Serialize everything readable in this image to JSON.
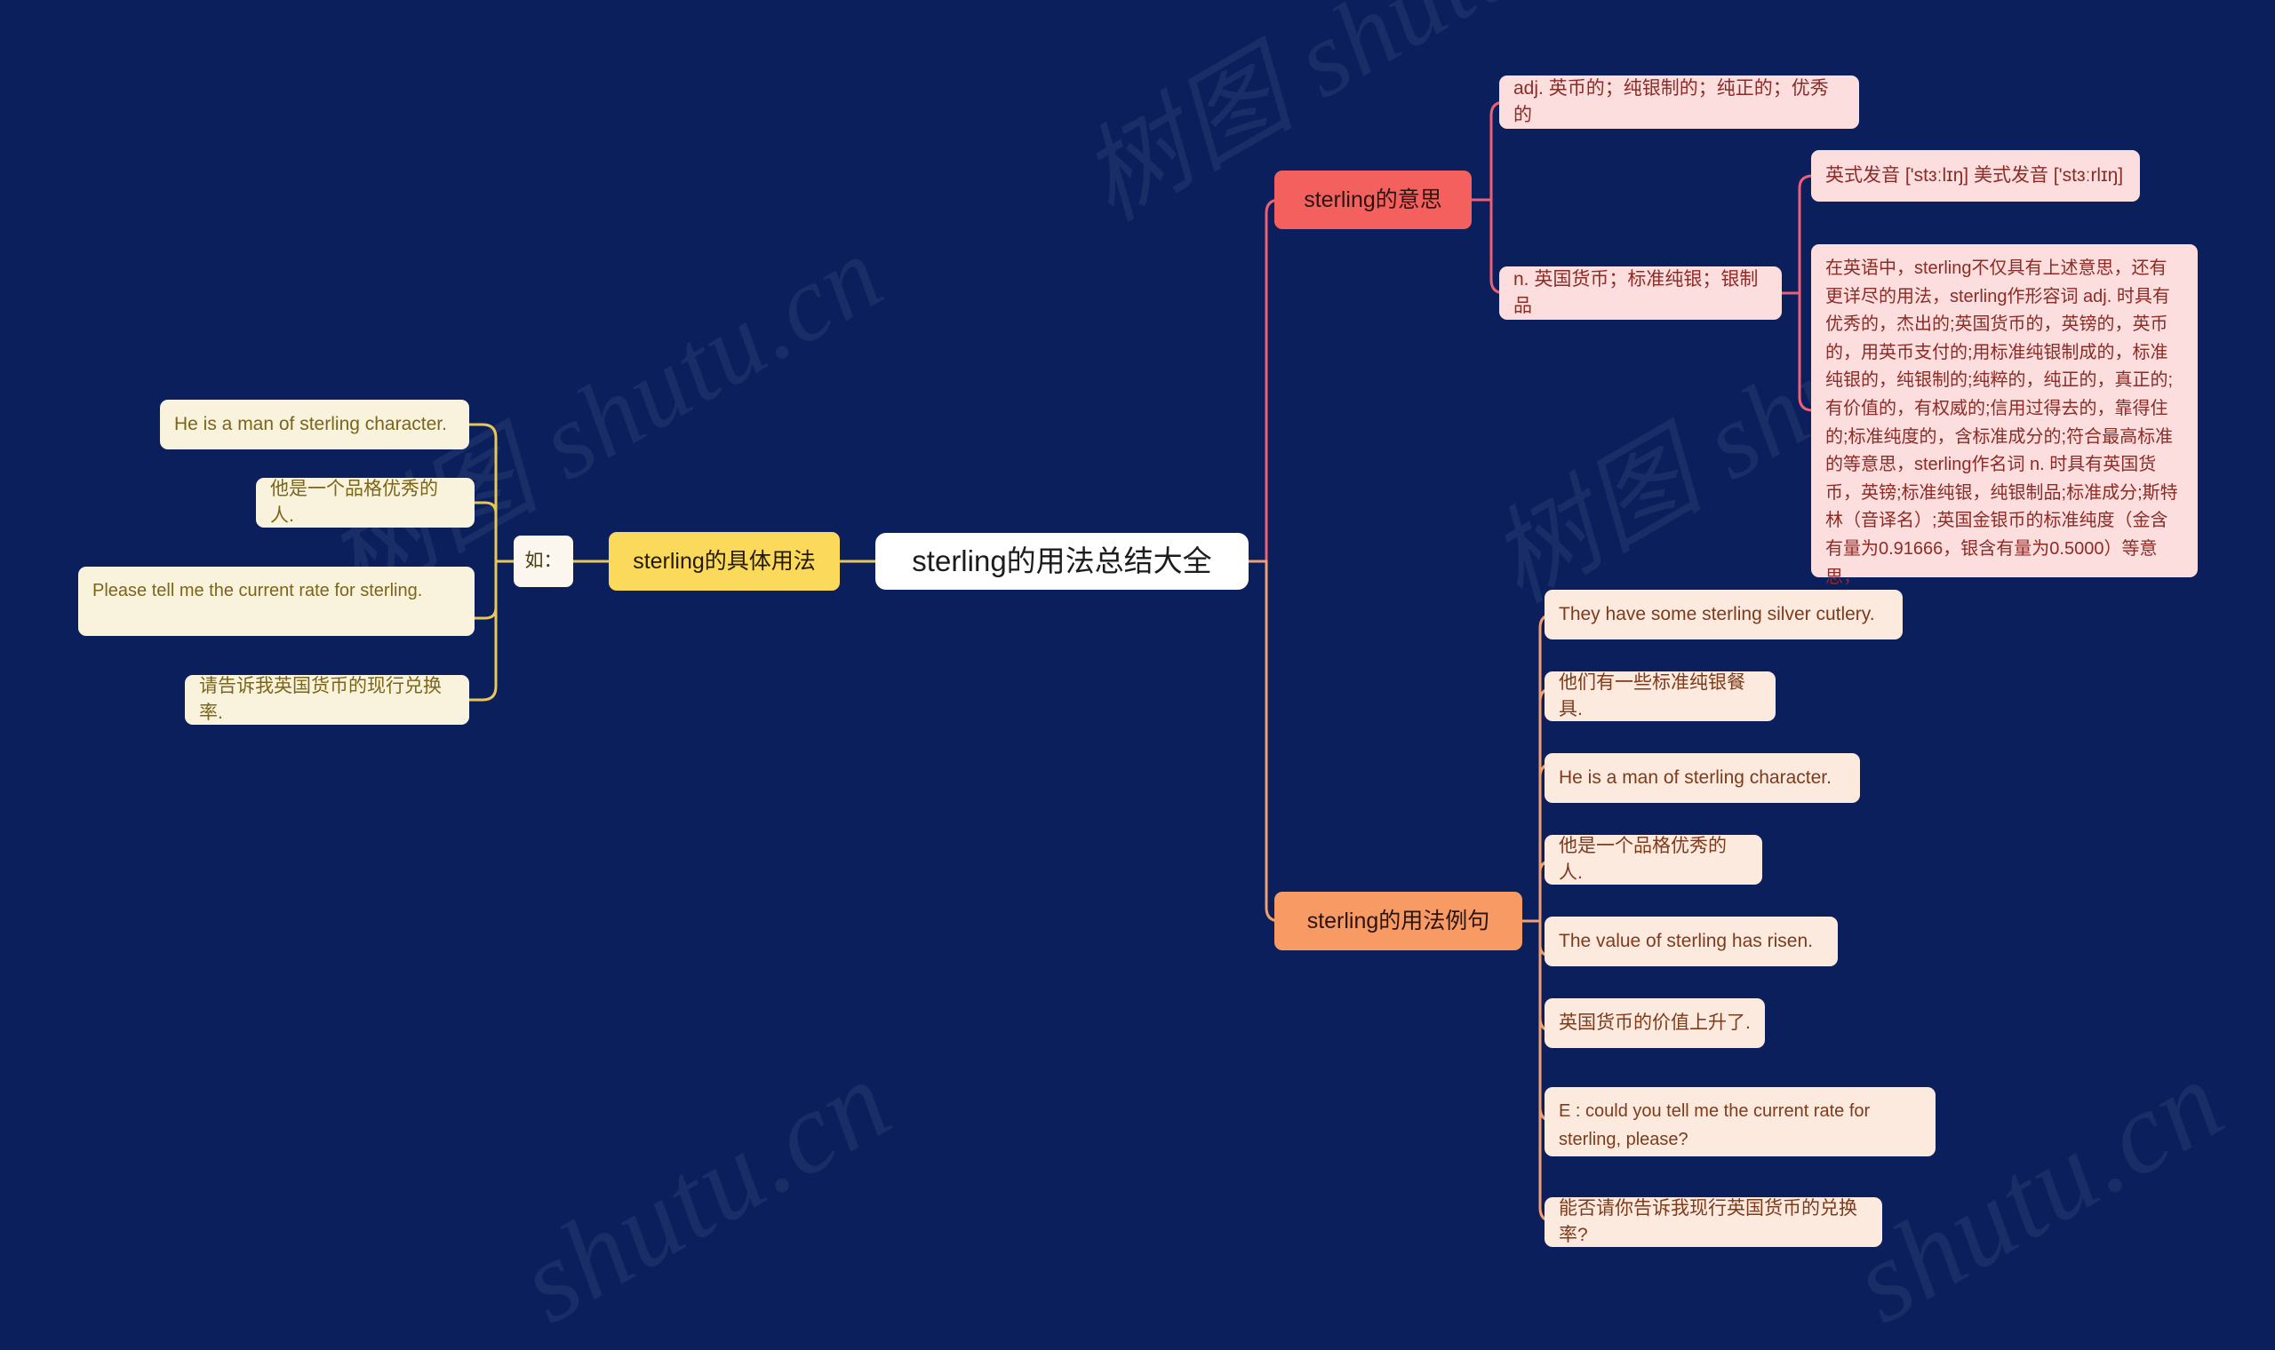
{
  "meta": {
    "background_color": "#0a1f5c",
    "watermark_text_cn": "树图 shutu.cn",
    "watermark_text_en": "shutu.cn"
  },
  "root": {
    "label": "sterling的用法总结大全",
    "color": "#ffffff"
  },
  "branches": [
    {
      "id": "meaning",
      "label": "sterling的意思",
      "color": "#f4605e",
      "children": [
        {
          "label": "adj. 英币的；纯银制的；纯正的；优秀的",
          "color": "#fbdedd"
        },
        {
          "label": "n. 英国货币；标准纯银；银制品",
          "color": "#fbdedd",
          "children": [
            {
              "label": "英式发音 ['stɜːlɪŋ] 美式发音 ['stɜːrlɪŋ]",
              "color": "#fbdedd"
            },
            {
              "label": "在英语中，sterling不仅具有上述意思，还有更详尽的用法，sterling作形容词 adj. 时具有优秀的，杰出的;英国货币的，英镑的，英币的，用英币支付的;用标准纯银制成的，标准纯银的，纯银制的;纯粹的，纯正的，真正的;有价值的，有权威的;信用过得去的，靠得住的;标准纯度的，含标准成分的;符合最高标准的等意思，sterling作名词 n. 时具有英国货币，英镑;标准纯银，纯银制品;标准成分;斯特林（音译名）;英国金银币的标准纯度（金含有量为0.91666，银含有量为0.5000）等意思，",
              "color": "#fbdedd"
            }
          ]
        }
      ]
    },
    {
      "id": "examples",
      "label": "sterling的用法例句",
      "color": "#f79a63",
      "children": [
        {
          "label": "They have some sterling silver cutlery.",
          "color": "#fdeadf"
        },
        {
          "label": "他们有一些标准纯银餐具.",
          "color": "#fdeadf"
        },
        {
          "label": "He is a man of sterling character.",
          "color": "#fdeadf"
        },
        {
          "label": "他是一个品格优秀的人.",
          "color": "#fdeadf"
        },
        {
          "label": "The value of sterling has risen.",
          "color": "#fdeadf"
        },
        {
          "label": "英国货币的价值上升了.",
          "color": "#fdeadf"
        },
        {
          "label": "E : could you tell me the current rate for sterling, please?",
          "color": "#fdeadf"
        },
        {
          "label": "能否请你告诉我现行英国货币的兑换率?",
          "color": "#fdeadf"
        }
      ]
    },
    {
      "id": "usage",
      "label": "sterling的具体用法",
      "color": "#fbd95b",
      "children": [
        {
          "label": "如：",
          "color": "#fbf7ef",
          "children": [
            {
              "label": "He is a man of sterling character.",
              "color": "#f9f3de"
            },
            {
              "label": "他是一个品格优秀的人.",
              "color": "#f9f3de"
            },
            {
              "label": "Please tell me the current rate for sterling.",
              "color": "#f9f3de"
            },
            {
              "label": "请告诉我英国货币的现行兑换率.",
              "color": "#f9f3de"
            }
          ]
        }
      ]
    }
  ],
  "wire_colors": {
    "meaning": "#ef5f74",
    "examples": "#f0a06e",
    "usage": "#e8c75a"
  }
}
